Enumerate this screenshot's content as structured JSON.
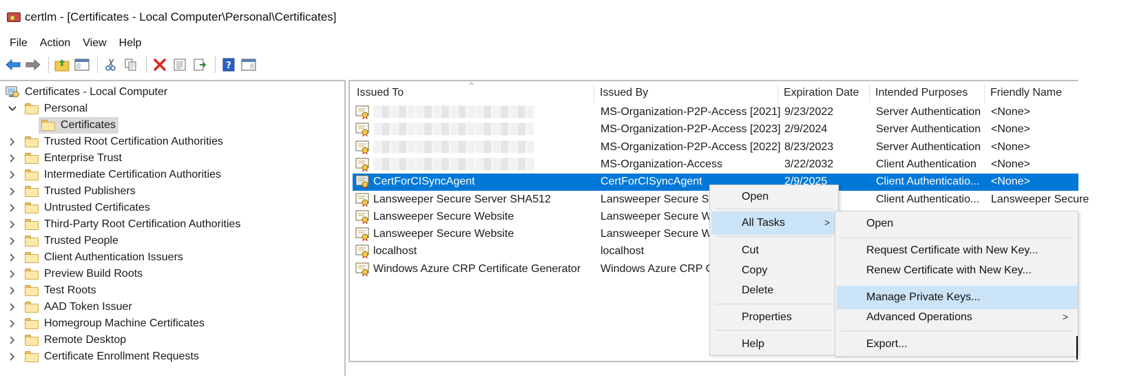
{
  "window": {
    "title": "certlm - [Certificates - Local Computer\\Personal\\Certificates]"
  },
  "menubar": [
    "File",
    "Action",
    "View",
    "Help"
  ],
  "toolbar": {
    "buttons": [
      "back-icon",
      "forward-icon",
      "up-folder-icon",
      "show-hide-tree-icon",
      "cut-icon",
      "copy-icon",
      "delete-icon",
      "properties-icon",
      "export-list-icon",
      "help-icon",
      "action-pane-icon"
    ]
  },
  "tree": {
    "root": "Certificates - Local Computer",
    "personal": "Personal",
    "certificates": "Certificates",
    "items": [
      "Trusted Root Certification Authorities",
      "Enterprise Trust",
      "Intermediate Certification Authorities",
      "Trusted Publishers",
      "Untrusted Certificates",
      "Third-Party Root Certification Authorities",
      "Trusted People",
      "Client Authentication Issuers",
      "Preview Build Roots",
      "Test Roots",
      "AAD Token Issuer",
      "Homegroup Machine Certificates",
      "Remote Desktop",
      "Certificate Enrollment Requests"
    ]
  },
  "list": {
    "columns": [
      "Issued To",
      "Issued By",
      "Expiration Date",
      "Intended Purposes",
      "Friendly Name"
    ],
    "rows": [
      {
        "issued_to": "",
        "issued_by": "MS-Organization-P2P-Access [2021]",
        "expiration": "9/23/2022",
        "purposes": "Server Authentication",
        "friendly": "<None>",
        "blurred": true
      },
      {
        "issued_to": "",
        "issued_by": "MS-Organization-P2P-Access [2023]",
        "expiration": "2/9/2024",
        "purposes": "Server Authentication",
        "friendly": "<None>",
        "blurred": true
      },
      {
        "issued_to": "",
        "issued_by": "MS-Organization-P2P-Access [2022]",
        "expiration": "8/23/2023",
        "purposes": "Server Authentication",
        "friendly": "<None>",
        "blurred": true
      },
      {
        "issued_to": "",
        "issued_by": "MS-Organization-Access",
        "expiration": "3/22/2032",
        "purposes": "Client Authentication",
        "friendly": "<None>",
        "blurred": true
      },
      {
        "issued_to": "CertForCISyncAgent",
        "issued_by": "CertForCISyncAgent",
        "expiration": "2/9/2025",
        "purposes": "Client Authenticatio...",
        "friendly": "<None>",
        "selected": true
      },
      {
        "issued_to": "Lansweeper Secure Server SHA512",
        "issued_by": "Lansweeper Secure Serv",
        "expiration": "",
        "purposes": "Client Authenticatio...",
        "friendly": "Lansweeper Secure"
      },
      {
        "issued_to": "Lansweeper Secure Website",
        "issued_by": "Lansweeper Secure Web",
        "expiration": "",
        "purposes": "",
        "friendly": ""
      },
      {
        "issued_to": "Lansweeper Secure Website",
        "issued_by": "Lansweeper Secure Web",
        "expiration": "",
        "purposes": "",
        "friendly": ""
      },
      {
        "issued_to": "localhost",
        "issued_by": "localhost",
        "expiration": "",
        "purposes": "",
        "friendly": ""
      },
      {
        "issued_to": "Windows Azure CRP Certificate Generator",
        "issued_by": "Windows Azure CRP Ce",
        "expiration": "",
        "purposes": "",
        "friendly": ""
      }
    ]
  },
  "context_menu": {
    "items": [
      "Open",
      "All Tasks",
      "Cut",
      "Copy",
      "Delete",
      "Properties",
      "Help"
    ],
    "highlighted": "All Tasks"
  },
  "submenu": {
    "items": [
      "Open",
      "Request Certificate with New Key...",
      "Renew Certificate with New Key...",
      "Manage Private Keys...",
      "Advanced Operations",
      "Export..."
    ],
    "highlighted": "Manage Private Keys..."
  },
  "colors": {
    "selection": "#0078d7",
    "menu_highlight": "#cce4f7",
    "menu_bg": "#f2f2f2"
  }
}
